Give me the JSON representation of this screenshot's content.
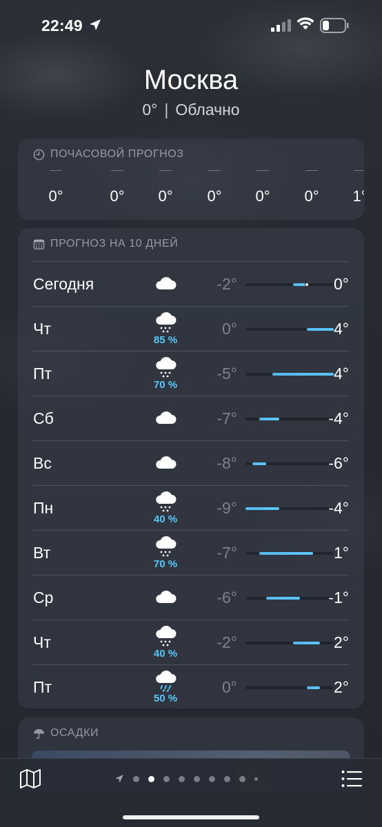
{
  "status_bar": {
    "time": "22:49",
    "icons": [
      "location-arrow-icon",
      "cellular-signal-icon",
      "wifi-icon",
      "battery-icon"
    ]
  },
  "header": {
    "city": "Москва",
    "temperature": "0°",
    "separator": "|",
    "condition": "Облачно"
  },
  "hourly": {
    "title": "ПОЧАСОВОЙ ПРОГНОЗ",
    "icon": "clock-icon",
    "items": [
      {
        "time": "—",
        "temp": "0°"
      },
      {
        "time": "—",
        "temp": "0°"
      },
      {
        "time": "—",
        "temp": "0°"
      },
      {
        "time": "—",
        "temp": "0°"
      },
      {
        "time": "—",
        "temp": "0°"
      },
      {
        "time": "—",
        "temp": "0°"
      },
      {
        "time": "—",
        "temp": "1°"
      }
    ]
  },
  "daily": {
    "title": "ПРОГНОЗ НА 10 ДНЕЙ",
    "icon": "calendar-icon",
    "range_min": -9,
    "range_max": 4,
    "days": [
      {
        "day": "Сегодня",
        "icon": "cloud-icon",
        "precip": "",
        "low": "-2°",
        "high": "0°",
        "low_val": -2,
        "high_val": 0,
        "current": 0
      },
      {
        "day": "Чт",
        "icon": "cloud-snow-icon",
        "precip": "85 %",
        "low": "0°",
        "high": "4°",
        "low_val": 0,
        "high_val": 4
      },
      {
        "day": "Пт",
        "icon": "cloud-snow-icon",
        "precip": "70 %",
        "low": "-5°",
        "high": "4°",
        "low_val": -5,
        "high_val": 4
      },
      {
        "day": "Сб",
        "icon": "cloud-icon",
        "precip": "",
        "low": "-7°",
        "high": "-4°",
        "low_val": -7,
        "high_val": -4
      },
      {
        "day": "Вс",
        "icon": "cloud-icon",
        "precip": "",
        "low": "-8°",
        "high": "-6°",
        "low_val": -8,
        "high_val": -6
      },
      {
        "day": "Пн",
        "icon": "cloud-snow-icon",
        "precip": "40 %",
        "low": "-9°",
        "high": "-4°",
        "low_val": -9,
        "high_val": -4
      },
      {
        "day": "Вт",
        "icon": "cloud-snow-icon",
        "precip": "70 %",
        "low": "-7°",
        "high": "1°",
        "low_val": -7,
        "high_val": 1
      },
      {
        "day": "Ср",
        "icon": "cloud-icon",
        "precip": "",
        "low": "-6°",
        "high": "-1°",
        "low_val": -6,
        "high_val": -1
      },
      {
        "day": "Чт",
        "icon": "cloud-snow-icon",
        "precip": "40 %",
        "low": "-2°",
        "high": "2°",
        "low_val": -2,
        "high_val": 2
      },
      {
        "day": "Пт",
        "icon": "cloud-rain-icon",
        "precip": "50 %",
        "low": "0°",
        "high": "2°",
        "low_val": 0,
        "high_val": 2
      }
    ]
  },
  "precipitation": {
    "title": "ОСАДКИ",
    "icon": "umbrella-icon"
  },
  "bottom_bar": {
    "map_icon": "map-icon",
    "list_icon": "list-icon",
    "pages_total": 9,
    "active_page": 1
  },
  "colors": {
    "accent": "#5ac8fa",
    "background": "#262a31"
  }
}
